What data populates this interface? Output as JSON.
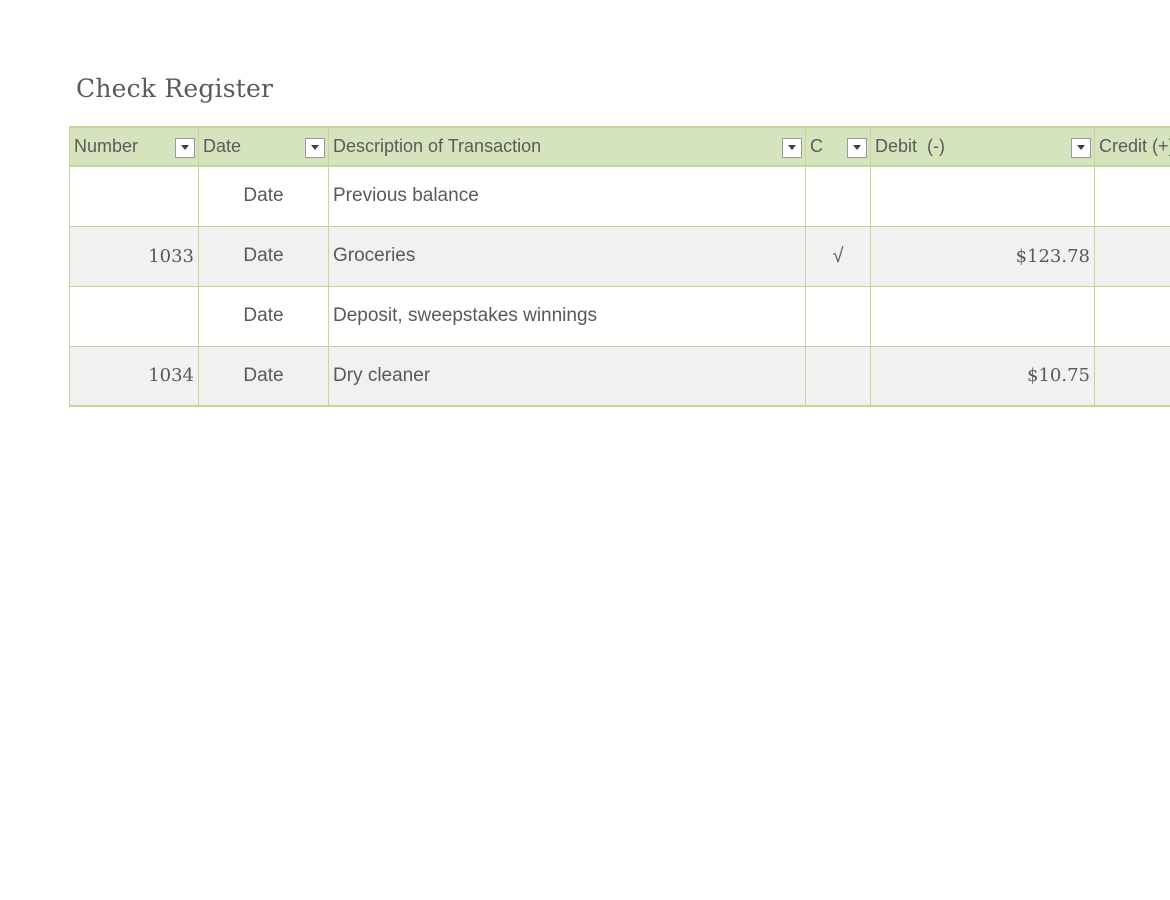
{
  "title": "Check Register",
  "columns": {
    "number": "Number",
    "date": "Date",
    "description": "Description of Transaction",
    "cleared": "C",
    "debit": "Debit  (-)",
    "credit": "Credit (+)"
  },
  "icons": {
    "filter": "dropdown-arrow-icon"
  },
  "colors": {
    "header_bg": "#d6e4bd",
    "border": "#c3d69b",
    "band_row_bg": "#f1f1f1"
  },
  "rows": [
    {
      "number": "",
      "date": "Date",
      "description": "Previous balance",
      "cleared": "",
      "debit": "",
      "credit": ""
    },
    {
      "number": "1033",
      "date": "Date",
      "description": "Groceries",
      "cleared": "√",
      "debit": "$123.78",
      "credit": ""
    },
    {
      "number": "",
      "date": "Date",
      "description": "Deposit, sweepstakes winnings",
      "cleared": "",
      "debit": "",
      "credit": ""
    },
    {
      "number": "1034",
      "date": "Date",
      "description": "Dry cleaner",
      "cleared": "",
      "debit": "$10.75",
      "credit": ""
    }
  ]
}
